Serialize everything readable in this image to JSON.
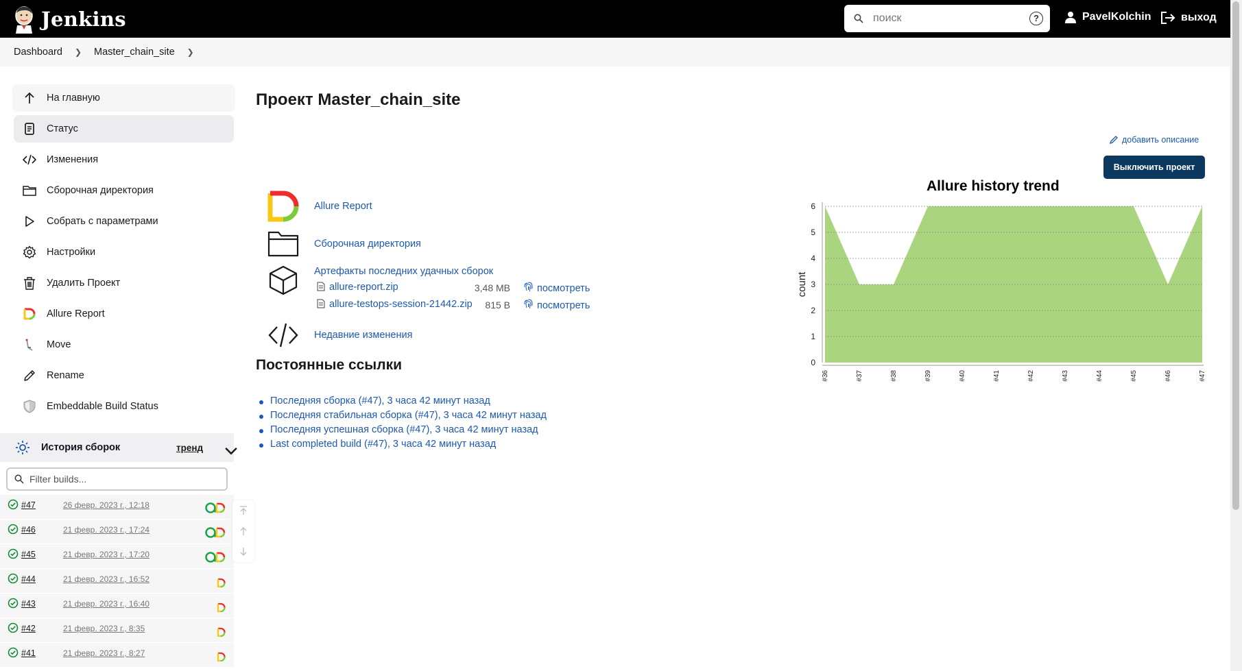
{
  "header": {
    "logo_text": "Jenkins",
    "search_placeholder": "поиск",
    "help_symbol": "?",
    "user_name": "PavelKolchin",
    "logout_label": "выход"
  },
  "breadcrumb": {
    "items": [
      "Dashboard",
      "Master_chain_site"
    ]
  },
  "sidebar": {
    "items": [
      {
        "label": "На главную",
        "icon": "arrow-up-icon"
      },
      {
        "label": "Статус",
        "icon": "document-icon"
      },
      {
        "label": "Изменения",
        "icon": "code-icon"
      },
      {
        "label": "Сборочная директория",
        "icon": "folder-icon"
      },
      {
        "label": "Собрать с параметрами",
        "icon": "play-icon"
      },
      {
        "label": "Настройки",
        "icon": "gear-icon"
      },
      {
        "label": "Удалить Проект",
        "icon": "trash-icon"
      },
      {
        "label": "Allure Report",
        "icon": "allure-icon"
      },
      {
        "label": "Move",
        "icon": "move-icon"
      },
      {
        "label": "Rename",
        "icon": "pencil-icon"
      },
      {
        "label": "Embeddable Build Status",
        "icon": "shield-icon"
      }
    ]
  },
  "build_history": {
    "title": "История сборок",
    "trend_label": "тренд",
    "filter_placeholder": "Filter builds...",
    "builds": [
      {
        "num": "#47",
        "date": "26 февр. 2023 г., 12:18",
        "has_allure_a": true
      },
      {
        "num": "#46",
        "date": "21 февр. 2023 г., 17:24",
        "has_allure_a": true
      },
      {
        "num": "#45",
        "date": "21 февр. 2023 г., 17:20",
        "has_allure_a": true
      },
      {
        "num": "#44",
        "date": "21 февр. 2023 г., 16:52",
        "has_allure_a": false
      },
      {
        "num": "#43",
        "date": "21 февр. 2023 г., 16:40",
        "has_allure_a": false
      },
      {
        "num": "#42",
        "date": "21 февр. 2023 г., 8:35",
        "has_allure_a": false
      },
      {
        "num": "#41",
        "date": "21 февр. 2023 г., 8:27",
        "has_allure_a": false
      }
    ]
  },
  "main": {
    "title": "Проект Master_chain_site",
    "add_description": "добавить описание",
    "disable_button": "Выключить проект",
    "links": {
      "allure_report": "Allure Report",
      "workspace": "Сборочная директория",
      "artifacts_title": "Артефакты последних удачных сборок",
      "recent_changes": "Недавние изменения"
    },
    "artifacts": [
      {
        "name": "allure-report.zip",
        "size": "3,48 MB",
        "view": "посмотреть"
      },
      {
        "name": "allure-testops-session-21442.zip",
        "size": "815 B",
        "view": "посмотреть"
      }
    ],
    "permalinks_title": "Постоянные ссылки",
    "permalinks": [
      "Последняя сборка (#47), 3 часа 42 минут назад",
      "Последняя стабильная сборка (#47), 3 часа 42 минут назад",
      "Последняя успешная сборка (#47), 3 часа 42 минут назад",
      "Last completed build (#47), 3 часа 42 минут назад"
    ]
  },
  "colors": {
    "header_bg": "#000000",
    "link": "#1c59b0",
    "button_bg": "#0b3960",
    "chart_fill": "#aad57e",
    "success": "#138a36"
  },
  "chart_data": {
    "type": "area",
    "title": "Allure history trend",
    "xlabel": "",
    "ylabel": "count",
    "categories": [
      "#36",
      "#37",
      "#38",
      "#39",
      "#40",
      "#41",
      "#42",
      "#43",
      "#44",
      "#45",
      "#46",
      "#47"
    ],
    "series": [
      {
        "values": [
          6,
          3,
          3,
          6,
          6,
          6,
          6,
          6,
          6,
          6,
          3,
          6
        ]
      }
    ],
    "ylim": [
      0,
      6
    ],
    "yticks": [
      0,
      1,
      2,
      3,
      4,
      5,
      6
    ],
    "grid": true
  }
}
